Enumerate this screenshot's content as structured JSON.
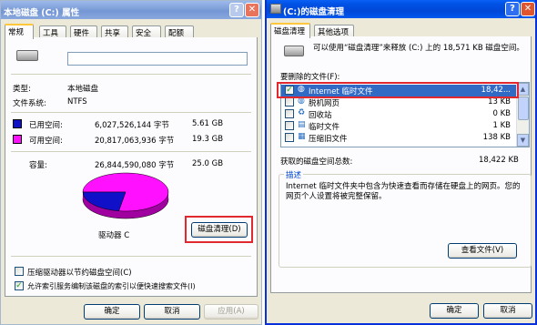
{
  "left_window": {
    "title": "本地磁盘 (C:) 属性",
    "tabs": [
      "常规",
      "工具",
      "硬件",
      "共享",
      "安全",
      "配额"
    ],
    "type_label": "类型:",
    "type_value": "本地磁盘",
    "fs_label": "文件系统:",
    "fs_value": "NTFS",
    "used_label": "已用空间:",
    "used_bytes": "6,027,526,144 字节",
    "used_gb": "5.61 GB",
    "free_label": "可用空间:",
    "free_bytes": "20,817,063,936 字节",
    "free_gb": "19.3 GB",
    "cap_label": "容量:",
    "cap_bytes": "26,844,590,080 字节",
    "cap_gb": "25.0 GB",
    "drive_label": "驱动器 C",
    "cleanup_button": "磁盘清理(D)",
    "compress_label": "压缩驱动器以节约磁盘空间(C)",
    "index_label": "允许索引服务编制该磁盘的索引以便快速搜索文件(I)",
    "ok": "确定",
    "cancel": "取消",
    "apply": "应用(A)",
    "used_color": "#1010c8",
    "free_color": "#ff10ff",
    "used_fraction": 0.2245
  },
  "right_window": {
    "title": "(C:)的磁盘清理",
    "tabs": [
      "磁盘清理",
      "其他选项"
    ],
    "intro": "可以使用“磁盘清理”来释放 (C:) 上的 18,571 KB 磁盘空间。",
    "files_label": "要删除的文件(F):",
    "files": [
      {
        "name": "Internet 临时文件",
        "size": "18,42...",
        "checked": true,
        "icon": "globe-icon"
      },
      {
        "name": "脱机网页",
        "size": "13 KB",
        "checked": false,
        "icon": "globe-icon"
      },
      {
        "name": "回收站",
        "size": "0 KB",
        "checked": false,
        "icon": "recycle-bin-icon"
      },
      {
        "name": "临时文件",
        "size": "1 KB",
        "checked": false,
        "icon": "file-icon"
      },
      {
        "name": "压缩旧文件",
        "size": "138 KB",
        "checked": false,
        "icon": "compress-icon"
      }
    ],
    "total_label": "获取的磁盘空间总数:",
    "total_value": "18,422 KB",
    "desc_title": "描述",
    "desc_text": "Internet 临时文件夹中包含为快速查看而存储在硬盘上的网页。您的网页个人设置将被完整保留。",
    "view_files": "查看文件(V)",
    "ok": "确定",
    "cancel": "取消"
  }
}
